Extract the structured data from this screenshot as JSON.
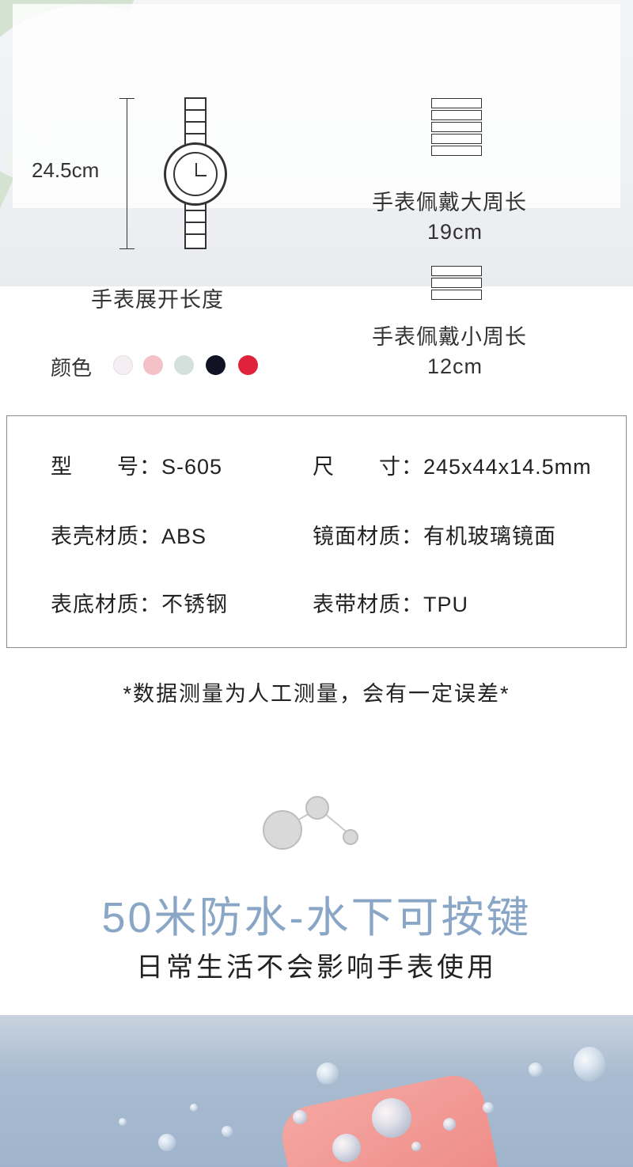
{
  "diagram": {
    "length_label": "24.5cm",
    "length_caption": "手表展开长度",
    "large_caption": "手表佩戴大周长",
    "large_value": "19cm",
    "small_caption": "手表佩戴小周长",
    "small_value": "12cm"
  },
  "colors": {
    "label": "颜色",
    "swatches": [
      "#f5eef2",
      "#f4c2c6",
      "#d4e0dc",
      "#111324",
      "#e0233a"
    ]
  },
  "specs": {
    "model_label": "型　　号：",
    "model_value": "S-605",
    "size_label": "尺　　寸：",
    "size_value": "245x44x14.5mm",
    "case_label": "表壳材质：",
    "case_value": "ABS",
    "mirror_label": "镜面材质：",
    "mirror_value": "有机玻璃镜面",
    "back_label": "表底材质：",
    "back_value": "不锈钢",
    "strap_label": "表带材质：",
    "strap_value": "TPU"
  },
  "note": "*数据测量为人工测量，会有一定误差*",
  "waterproof": {
    "headline": "50米防水-水下可按键",
    "subline": "日常生活不会影响手表使用",
    "accent_color": "#8aa6c6"
  }
}
